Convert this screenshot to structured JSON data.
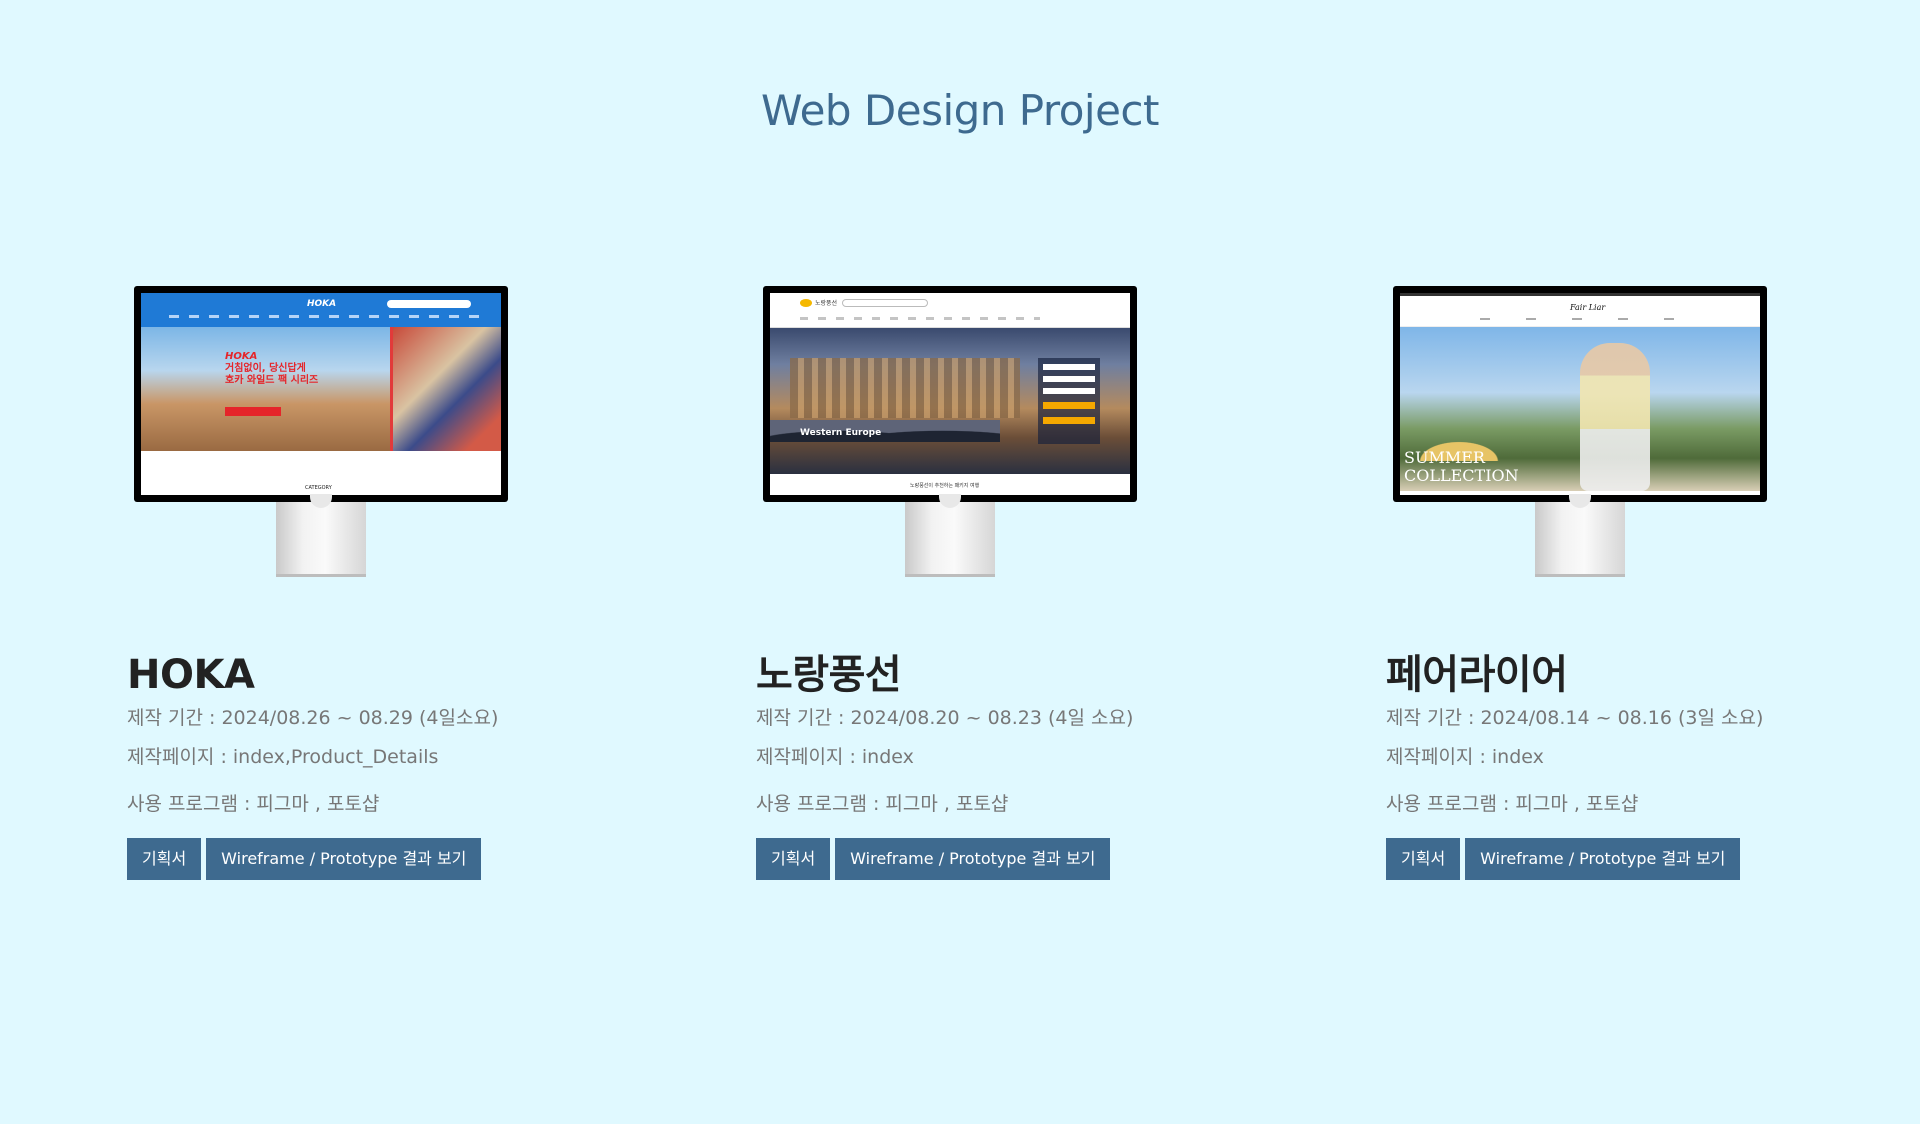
{
  "page": {
    "title": "Web Design Project"
  },
  "projects": [
    {
      "name": "HOKA",
      "period": "제작 기간 :  2024/08.26 ~ 08.29  (4일소요)",
      "pages": "제작페이지 : index,Product_Details",
      "tools": "사용 프로그램 : 피그마 , 포토샵",
      "plan_label": "기획서",
      "result_label": "Wireframe / Prototype 결과 보기",
      "screen": {
        "logo": "HOKA",
        "headline_1": "HOKA",
        "headline_2": "거침없이, 당신답게",
        "headline_3": "호카 와일드 팩 시리즈",
        "footer": "CATEGORY"
      }
    },
    {
      "name": "노랑풍선",
      "period": "제작 기간 :   2024/08.20 ~ 08.23  (4일 소요)",
      "pages": "제작페이지 : index",
      "tools": "사용 프로그램 : 피그마 , 포토샵",
      "plan_label": "기획서",
      "result_label": "Wireframe / Prototype 결과 보기",
      "screen": {
        "logo": "노랑풍선",
        "caption": "Western Europe",
        "footer": "노랑풍선이 추천하는 패키지 여행"
      }
    },
    {
      "name": "페어라이어",
      "period": "제작 기간 :   2024/08.14 ~ 08.16  (3일 소요)",
      "pages": "제작페이지 : index",
      "tools": "사용 프로그램 : 피그마 , 포토샵",
      "plan_label": "기획서",
      "result_label": "Wireframe / Prototype 결과 보기",
      "screen": {
        "logo": "Fair Liar",
        "caption_1": "SUMMER",
        "caption_2": "COLLECTION"
      }
    }
  ],
  "colors": {
    "background": "#e0f9ff",
    "accent": "#3e6a8f"
  }
}
